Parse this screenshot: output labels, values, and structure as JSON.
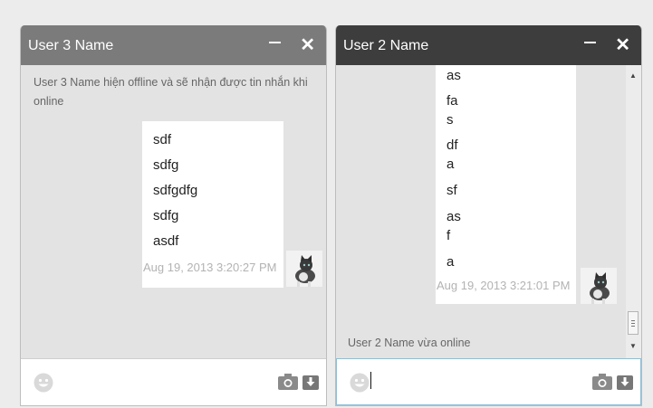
{
  "chat1": {
    "title": "User 3 Name",
    "minimize_label": "—",
    "close_label": "✕",
    "offline_notice": "User 3 Name hiện offline và sẽ nhận được tin nhắn khi online",
    "messages": [
      "sdf",
      "sdfg",
      "sdfgdfg",
      "sdfg",
      "asdf"
    ],
    "timestamp": "Aug 19, 2013 3:20:27 PM",
    "input_value": "",
    "icons": [
      "smiley-icon",
      "camera-icon",
      "file-upload-icon"
    ]
  },
  "chat2": {
    "title": "User 2 Name",
    "minimize_label": "—",
    "close_label": "✕",
    "messages": [
      "as",
      "fa",
      "s",
      "df",
      "a",
      "sf",
      "as",
      "f",
      "a"
    ],
    "timestamp": "Aug 19, 2013 3:21:01 PM",
    "status_text": "User 2 Name vừa online",
    "input_value": "",
    "scroll_up": "▲",
    "scroll_down": "▼",
    "icons": [
      "smiley-icon",
      "camera-icon",
      "file-upload-icon"
    ]
  },
  "colors": {
    "header_inactive": "#7b7b7b",
    "header_active": "#3d3d3d",
    "input_focus_border": "#7dc3e8"
  }
}
